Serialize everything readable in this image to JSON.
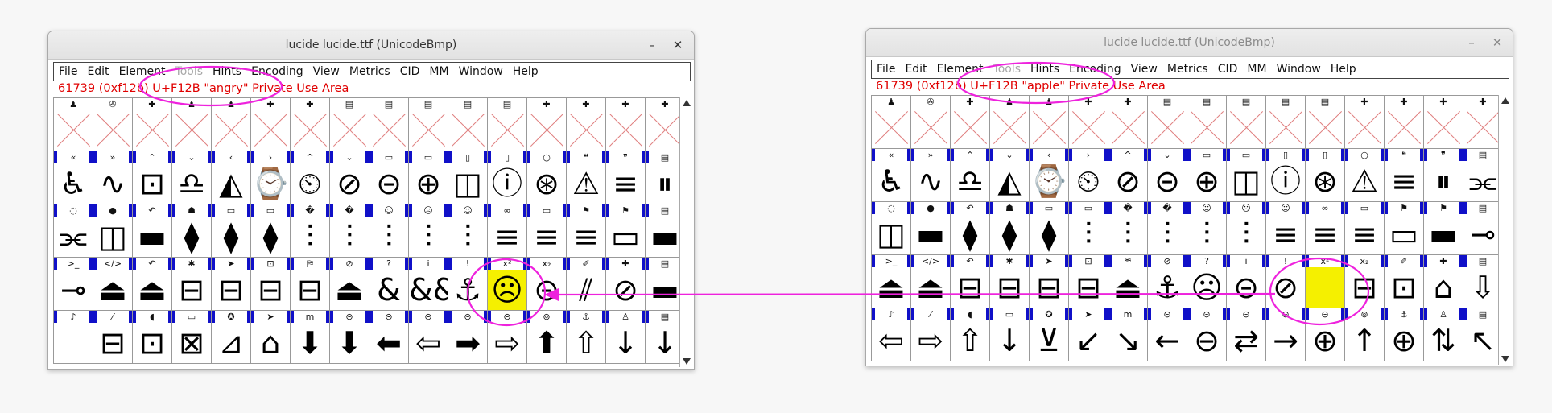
{
  "colors": {
    "annotation": "#ee22dd",
    "selected": "#f5f000",
    "info": "#e00000",
    "labelbar": "#1010c8"
  },
  "left": {
    "title": "lucide  lucide.ttf (UnicodeBmp)",
    "minimize": "–",
    "close": "✕",
    "menus": [
      "File",
      "Edit",
      "Element",
      "Tools",
      "Hints",
      "Encoding",
      "View",
      "Metrics",
      "CID",
      "MM",
      "Window",
      "Help"
    ],
    "info": "61739 (0xf12b) U+F12B \"angry\" Private Use Area",
    "rows": [
      {
        "labels": [
          "♟",
          "✇",
          "✚",
          "♟",
          "♟",
          "✚",
          "✚",
          "▤",
          "▤",
          "▤",
          "▤",
          "▤",
          "✚",
          "✚",
          "✚",
          "✚"
        ],
        "glyphs": [
          "",
          "",
          "",
          "",
          "",
          "",
          "",
          "",
          "",
          "",
          "",
          "",
          "",
          "",
          "",
          ""
        ],
        "empty": true
      },
      {
        "labels": [
          "«",
          "»",
          "⌃",
          "⌄",
          "‹",
          "›",
          "^",
          "⌄",
          "▭",
          "▭",
          "▯",
          "▯",
          "○",
          "❝",
          "❞",
          "▤"
        ],
        "glyphs": [
          "♿",
          "∿",
          "⊡",
          "♎",
          "◭",
          "⌚",
          "⏲",
          "⊘",
          "⊝",
          "⊕",
          "◫",
          "ⓘ",
          "⊛",
          "⚠",
          "≡",
          "⏸"
        ]
      },
      {
        "labels": [
          "◌",
          "●",
          "↶",
          "☗",
          "▭",
          "▭",
          "�",
          "�",
          "☺",
          "☹",
          "☺",
          "∞",
          "▭",
          "⚑",
          "⚑",
          "▤"
        ],
        "glyphs": [
          "⫘",
          "◫",
          "▬",
          "⧫",
          "⧫",
          "⧫",
          "⫶",
          "⫶",
          "⫶",
          "⫶",
          "⫶",
          "≡",
          "≡",
          "≡",
          "▭",
          "▬"
        ]
      },
      {
        "labels": [
          ">_",
          "</>",
          "↶",
          "✱",
          "➤",
          "⊡",
          "⛿",
          "⊘",
          "?",
          "i",
          "!",
          "x²",
          "x₂",
          "✐",
          "✚",
          "▤"
        ],
        "glyphs": [
          "⊸",
          "⏏",
          "⏏",
          "⊟",
          "⊟",
          "⊟",
          "⊟",
          "⏏",
          "&",
          "&&",
          "⚓",
          "☹",
          "⊝",
          "⫽",
          "⊘",
          "▬"
        ]
      },
      {
        "labels": [
          "♪",
          "⁄",
          "◖",
          "▭",
          "✪",
          "➤",
          "m",
          "⊝",
          "⊝",
          "⊝",
          "⊝",
          "⊝",
          "⊚",
          "⚓",
          "♙",
          "▤"
        ],
        "glyphs": [
          "",
          "⊟",
          "⊡",
          "⊠",
          "⊿",
          "⌂",
          "⬇",
          "⬇",
          "⬅",
          "⇦",
          "➡",
          "⇨",
          "⬆",
          "⇧",
          "↓",
          "↓"
        ]
      }
    ]
  },
  "right": {
    "title": "lucide  lucide.ttf (UnicodeBmp)",
    "minimize": "–",
    "close": "✕",
    "menus": [
      "File",
      "Edit",
      "Element",
      "Tools",
      "Hints",
      "Encoding",
      "View",
      "Metrics",
      "CID",
      "MM",
      "Window",
      "Help"
    ],
    "info": "61739 (0xf12b) U+F12B \"apple\" Private Use Area",
    "rows": [
      {
        "labels": [
          "♟",
          "✇",
          "✚",
          "♟",
          "♟",
          "✚",
          "✚",
          "▤",
          "▤",
          "▤",
          "▤",
          "▤",
          "✚",
          "✚",
          "✚",
          "✚"
        ],
        "glyphs": [
          "",
          "",
          "",
          "",
          "",
          "",
          "",
          "",
          "",
          "",
          "",
          "",
          "",
          "",
          "",
          ""
        ],
        "empty": true
      },
      {
        "labels": [
          "«",
          "»",
          "⌃",
          "⌄",
          "‹",
          "›",
          "^",
          "⌄",
          "▭",
          "▭",
          "▯",
          "▯",
          "○",
          "❝",
          "❞",
          "▤"
        ],
        "glyphs": [
          "♿",
          "∿",
          "♎",
          "◭",
          "⌚",
          "⏲",
          "⊘",
          "⊝",
          "⊕",
          "◫",
          "ⓘ",
          "⊛",
          "⚠",
          "≡",
          "⏸",
          "⫘"
        ]
      },
      {
        "labels": [
          "◌",
          "●",
          "↶",
          "☗",
          "▭",
          "▭",
          "�",
          "�",
          "☺",
          "☹",
          "☺",
          "∞",
          "▭",
          "⚑",
          "⚑",
          "▤"
        ],
        "glyphs": [
          "◫",
          "▬",
          "⧫",
          "⧫",
          "⧫",
          "⫶",
          "⫶",
          "⫶",
          "⫶",
          "⫶",
          "≡",
          "≡",
          "≡",
          "▭",
          "▬",
          "⊸"
        ]
      },
      {
        "labels": [
          ">_",
          "</>",
          "↶",
          "✱",
          "➤",
          "⊡",
          "⛿",
          "⊘",
          "?",
          "i",
          "!",
          "x²",
          "x₂",
          "✐",
          "✚",
          "▤"
        ],
        "glyphs": [
          "⏏",
          "⏏",
          "⊟",
          "⊟",
          "⊟",
          "⊟",
          "⏏",
          "⚓",
          "☹",
          "⊝",
          "⊘",
          "",
          "⊟",
          "⊡",
          "⌂",
          "⇩"
        ]
      },
      {
        "labels": [
          "♪",
          "⁄",
          "◖",
          "▭",
          "✪",
          "➤",
          "m",
          "⊝",
          "⊝",
          "⊝",
          "⊝",
          "⊝",
          "⊚",
          "⚓",
          "♙",
          "▤"
        ],
        "glyphs": [
          "⇦",
          "⇨",
          "⇧",
          "↓",
          "⊻",
          "↙",
          "↘",
          "←",
          "⊖",
          "⇄",
          "→",
          "⊕",
          "↑",
          "⊕",
          "⇅",
          "↖"
        ]
      }
    ]
  }
}
